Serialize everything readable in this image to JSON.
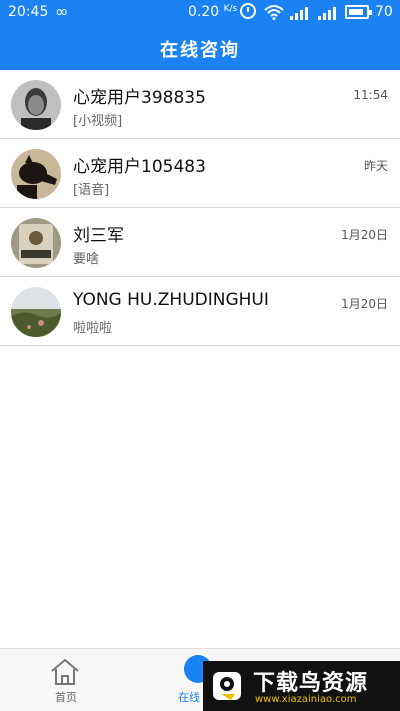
{
  "status_bar": {
    "time": "20:45",
    "speed": "0.20",
    "speed_unit": "K/s",
    "battery": "70",
    "icons": [
      "infinity-icon",
      "alarm-icon",
      "wifi-icon",
      "signal-icon",
      "battery-icon"
    ]
  },
  "app_bar": {
    "title": "在线咨询"
  },
  "conversations": [
    {
      "name": "心宠用户398835",
      "last_message": "[小视频]",
      "time": "11:54",
      "avatar": "avatar-man-portrait"
    },
    {
      "name": "心宠用户105483",
      "last_message": "[语音]",
      "time": "昨天",
      "avatar": "avatar-black-dog"
    },
    {
      "name": "刘三军",
      "last_message": "要啥",
      "time": "1月20日",
      "avatar": "avatar-can-product"
    },
    {
      "name": "YONG HU.ZHUDINGHUI",
      "last_message": "啦啦啦",
      "time": "1月20日",
      "avatar": "avatar-field-landscape"
    }
  ],
  "bottom_nav": {
    "home_label": "首页",
    "consult_label": "在线"
  },
  "watermark": {
    "title": "下载鸟资源",
    "url": "www.xiazainiao.com"
  },
  "colors": {
    "primary": "#1a82f2",
    "divider": "#d6d6d6"
  }
}
